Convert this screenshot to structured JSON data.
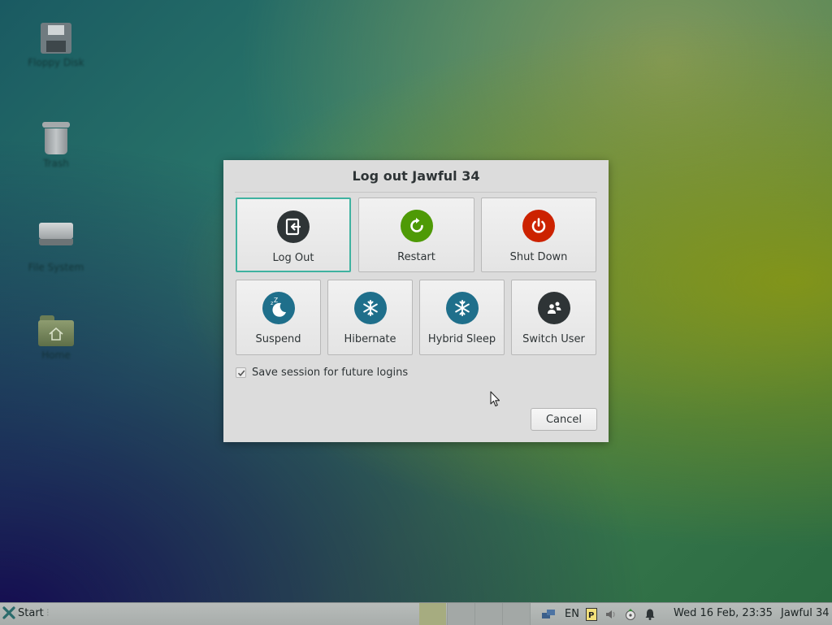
{
  "desktop": {
    "icons": [
      {
        "label": "Floppy Disk",
        "icon": "floppy-disk-icon"
      },
      {
        "label": "Trash",
        "icon": "trash-icon"
      },
      {
        "label": "File System",
        "icon": "hard-drive-icon"
      },
      {
        "label": "Home",
        "icon": "home-folder-icon"
      }
    ]
  },
  "dialog": {
    "title": "Log out Jawful 34",
    "actions_row1": [
      {
        "label": "Log Out",
        "icon": "logout-icon",
        "color": "#2e3436",
        "selected": true
      },
      {
        "label": "Restart",
        "icon": "restart-icon",
        "color": "#4e9a06"
      },
      {
        "label": "Shut Down",
        "icon": "power-icon",
        "color": "#cc2200"
      }
    ],
    "actions_row2": [
      {
        "label": "Suspend",
        "icon": "moon-icon",
        "color": "#1f6f8b"
      },
      {
        "label": "Hibernate",
        "icon": "snowflake-icon",
        "color": "#1f6f8b"
      },
      {
        "label": "Hybrid Sleep",
        "icon": "snowflake-icon",
        "color": "#1f6f8b"
      },
      {
        "label": "Switch User",
        "icon": "users-icon",
        "color": "#2e3436"
      }
    ],
    "save_session": {
      "label": "Save session for future logins",
      "checked": true
    },
    "cancel_label": "Cancel",
    "accent": "#3fb2a0"
  },
  "taskbar": {
    "start_label": "Start",
    "keyboard_layout": "EN",
    "clock": "Wed 16 Feb, 23:35",
    "user": "Jawful 34"
  }
}
